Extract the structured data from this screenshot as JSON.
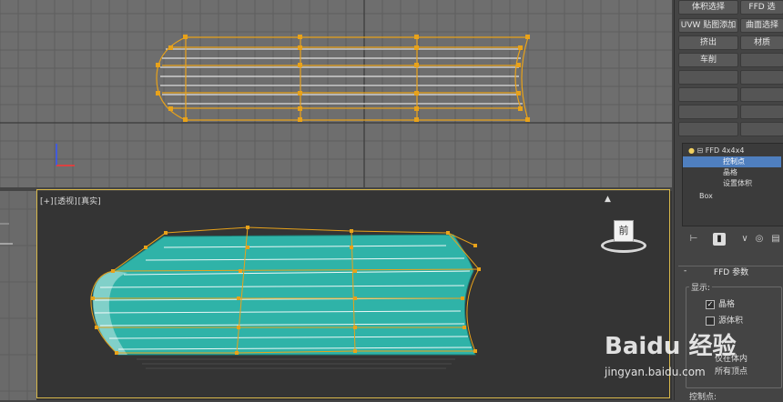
{
  "viewports": {
    "perspective": {
      "label_parts": [
        "[+]",
        "[透视]",
        "[真实]"
      ]
    }
  },
  "view_cube": {
    "face_label": "前"
  },
  "command_panel": {
    "modifier_buttons": [
      "体积选择",
      "FFD 选",
      "UVW 贴图添加",
      "曲面选择",
      "挤出",
      "材质",
      "车削"
    ],
    "modifier_stack": {
      "items": [
        {
          "label": "FFD 4x4x4",
          "level": 0,
          "selected": false
        },
        {
          "label": "控制点",
          "level": 1,
          "selected": true
        },
        {
          "label": "晶格",
          "level": 1,
          "selected": false
        },
        {
          "label": "设置体积",
          "level": 1,
          "selected": false
        },
        {
          "label": "Box",
          "level": 0,
          "selected": false
        }
      ]
    },
    "ffd_rollout": {
      "title": "FFD 参数",
      "collapse_symbol": "-",
      "display_group_label": "显示:",
      "lattice_checkbox": {
        "label": "晶格",
        "checked": true
      },
      "source_volume_checkbox": {
        "label": "源体积",
        "checked": false
      },
      "deform_radio_1": "仅在体内",
      "deform_radio_2": "所有顶点",
      "control_points_label": "控制点:"
    }
  },
  "watermark": {
    "logo_text": "Baidu 经验",
    "url": "jingyan.baidu.com"
  },
  "colors": {
    "lattice": "#e8a21a",
    "mesh_fill": "#2fb3a8",
    "selection": "#4f7fbf",
    "active_viewport_border": "#d8b84a"
  }
}
